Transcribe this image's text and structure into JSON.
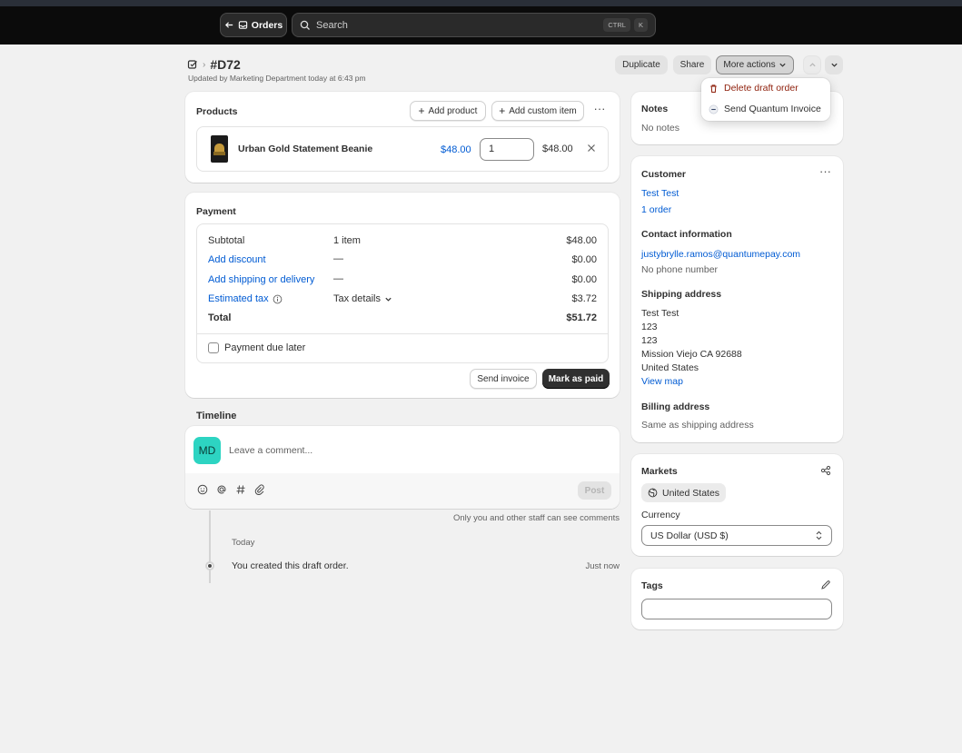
{
  "topbar": {
    "orders_label": "Orders",
    "search_placeholder": "Search",
    "shortcut_keys": [
      "CTRL",
      "K"
    ]
  },
  "header": {
    "order_number": "#D72",
    "updated_text": "Updated by Marketing Department today at 6:43 pm",
    "duplicate_label": "Duplicate",
    "share_label": "Share",
    "more_actions_label": "More actions"
  },
  "dropdown": {
    "items": [
      {
        "label": "Delete draft order",
        "icon": "trash-icon",
        "color": "#8e1f0b"
      },
      {
        "label": "Send Quantum Invoice",
        "icon": "quantum-icon",
        "color": "#303030"
      }
    ]
  },
  "products": {
    "title": "Products",
    "add_product_label": "Add product",
    "add_custom_item_label": "Add custom item",
    "items": [
      {
        "name": "Urban Gold Statement Beanie",
        "price": "$48.00",
        "quantity": "1",
        "total": "$48.00"
      }
    ]
  },
  "payment": {
    "title": "Payment",
    "subtotal_label": "Subtotal",
    "subtotal_items": "1 item",
    "subtotal_value": "$48.00",
    "discount_label": "Add discount",
    "discount_dash": "—",
    "discount_value": "$0.00",
    "shipping_label": "Add shipping or delivery",
    "shipping_dash": "—",
    "shipping_value": "$0.00",
    "tax_label": "Estimated tax",
    "tax_details_label": "Tax details",
    "tax_value": "$3.72",
    "total_label": "Total",
    "total_value": "$51.72",
    "due_later_label": "Payment due later",
    "send_invoice_label": "Send invoice",
    "mark_paid_label": "Mark as paid"
  },
  "timeline": {
    "title": "Timeline",
    "avatar_initials": "MD",
    "comment_placeholder": "Leave a comment...",
    "post_label": "Post",
    "privacy_note": "Only you and other staff can see comments",
    "day_label": "Today",
    "events": [
      {
        "text": "You created this draft order.",
        "time": "Just now"
      }
    ]
  },
  "notes": {
    "title": "Notes",
    "text": "No notes"
  },
  "customer": {
    "title": "Customer",
    "name": "Test Test",
    "orders": "1 order",
    "contact_title": "Contact information",
    "email": "justybrylle.ramos@quantumepay.com",
    "phone": "No phone number",
    "shipping_title": "Shipping address",
    "shipping_lines": [
      "Test Test",
      "123",
      "123",
      "Mission Viejo CA 92688",
      "United States"
    ],
    "view_map_label": "View map",
    "billing_title": "Billing address",
    "billing_text": "Same as shipping address"
  },
  "markets": {
    "title": "Markets",
    "market_badge": "United States",
    "currency_label": "Currency",
    "currency_value": "US Dollar (USD $)"
  },
  "tags": {
    "title": "Tags",
    "value": ""
  },
  "colors": {
    "link": "#005bd3",
    "danger": "#8e1f0b",
    "avatar": "#2dd4c2",
    "primary_button": "#303030"
  }
}
